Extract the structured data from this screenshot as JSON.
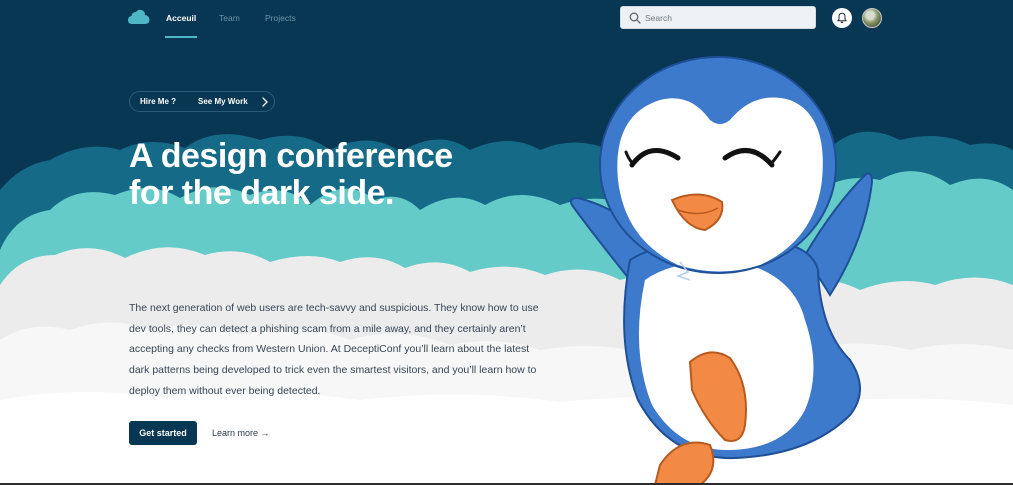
{
  "nav": {
    "logo_icon": "cloud-icon",
    "links": [
      {
        "label": "Acceuil",
        "active": true
      },
      {
        "label": "Team",
        "active": false
      },
      {
        "label": "Projects",
        "active": false
      }
    ],
    "search": {
      "placeholder": "Search",
      "value": "",
      "icon": "search-icon"
    },
    "notification_icon": "bell-icon",
    "avatar_icon": "user-avatar"
  },
  "hero": {
    "pill": {
      "hire_label": "Hire Me ?",
      "work_label": "See My Work",
      "chevron_icon": "chevron-right-icon"
    },
    "headline": "A design conference for the dark side.",
    "description": "The next generation of web users are tech-savvy and suspicious. They know how to use dev tools, they can detect a phishing scam from a mile away, and they certainly aren’t accepting any checks from Western Union. At DeceptiConf you’ll learn about the latest dark patterns being developed to trick even the smartest visitors, and you’ll learn how to deploy them without ever being detected.",
    "primary_button": "Get started",
    "secondary_link": "Learn more →"
  },
  "illustration": {
    "name": "penguin-mascot"
  },
  "colors": {
    "navy": "#073752",
    "teal_dark": "#146a87",
    "teal_light": "#64cbc8",
    "cloud_white": "#ececec",
    "penguin_blue": "#3d7acc",
    "penguin_orange": "#f28a45",
    "accent_underline": "#4fb6c6"
  }
}
